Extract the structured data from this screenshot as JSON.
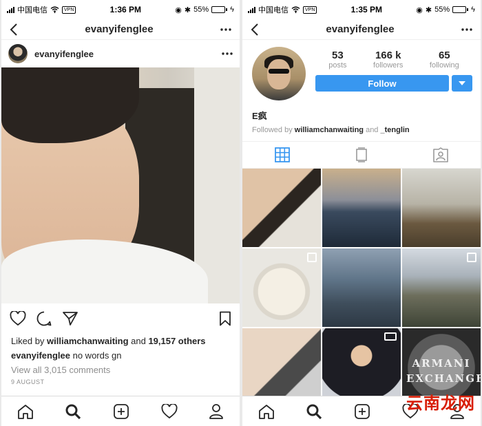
{
  "left": {
    "status": {
      "carrier": "中国电信",
      "vpn": "VPN",
      "time": "1:36 PM",
      "battery": "55%",
      "battery_level": 0.55
    },
    "nav": {
      "title": "evanyifenglee"
    },
    "post": {
      "username": "evanyifenglee",
      "liked_by_prefix": "Liked by ",
      "liked_by_user": "williamchanwaiting",
      "liked_by_and": " and ",
      "likes_count": "19,157 others",
      "caption_user": "evanyifenglee",
      "caption_text": " no words gn",
      "comments_link": "View all 3,015 comments",
      "date": "9 AUGUST"
    }
  },
  "right": {
    "status": {
      "carrier": "中国电信",
      "vpn": "VPN",
      "time": "1:35 PM",
      "battery": "55%",
      "battery_level": 0.55
    },
    "nav": {
      "title": "evanyifenglee"
    },
    "profile": {
      "stats": [
        {
          "num": "53",
          "label": "posts"
        },
        {
          "num": "166 k",
          "label": "followers"
        },
        {
          "num": "65",
          "label": "following"
        }
      ],
      "follow_label": "Follow",
      "name": "E疯",
      "followed_prefix": "Followed by ",
      "followed_user1": "williamchanwaiting",
      "followed_and": " and ",
      "followed_user2": "_tenglin"
    },
    "grid_text": "ARMANI EXCHANGE"
  },
  "watermark": "云南龙网",
  "colors": {
    "accent": "#3897f0",
    "watermark": "#d81e06"
  }
}
